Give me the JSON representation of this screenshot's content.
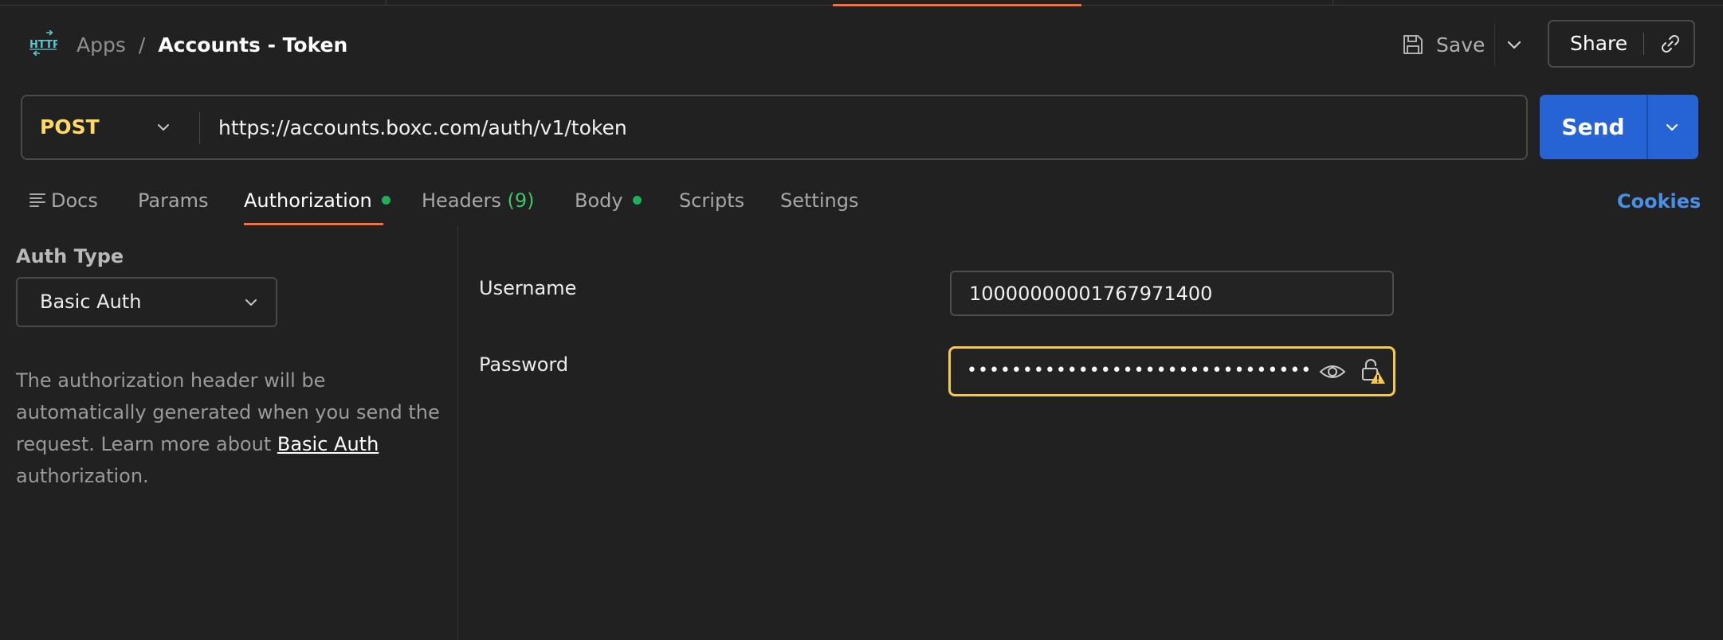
{
  "header": {
    "breadcrumb_root": "Apps",
    "breadcrumb_sep": "/",
    "title": "Accounts - Token",
    "save_label": "Save",
    "share_label": "Share",
    "icons": {
      "app": "http-icon",
      "save": "save-icon",
      "more": "chevron-down-icon",
      "link": "link-icon"
    }
  },
  "request": {
    "method": "POST",
    "url": "https://accounts.boxc.com/auth/v1/token",
    "send_label": "Send"
  },
  "tabs": {
    "docs": "Docs",
    "params": "Params",
    "authorization": "Authorization",
    "headers": "Headers",
    "headers_count": "(9)",
    "body": "Body",
    "scripts": "Scripts",
    "settings": "Settings",
    "active": "Authorization",
    "cookies": "Cookies"
  },
  "auth": {
    "type_label": "Auth Type",
    "type_value": "Basic Auth",
    "desc_before": "The authorization header will be automatically generated when you send the request. Learn more about ",
    "desc_link": "Basic Auth",
    "desc_after": " authorization."
  },
  "form": {
    "username_label": "Username",
    "username_value": "10000000001767971400",
    "password_label": "Password",
    "password_mask": "•••••••••••••••••••••••••••••••"
  },
  "colors": {
    "accent": "#ff6c37",
    "send": "#2664d6",
    "method": "#ffd866",
    "indicator": "#20b05a",
    "warning": "#f5c94d",
    "link": "#4a8fe6"
  }
}
